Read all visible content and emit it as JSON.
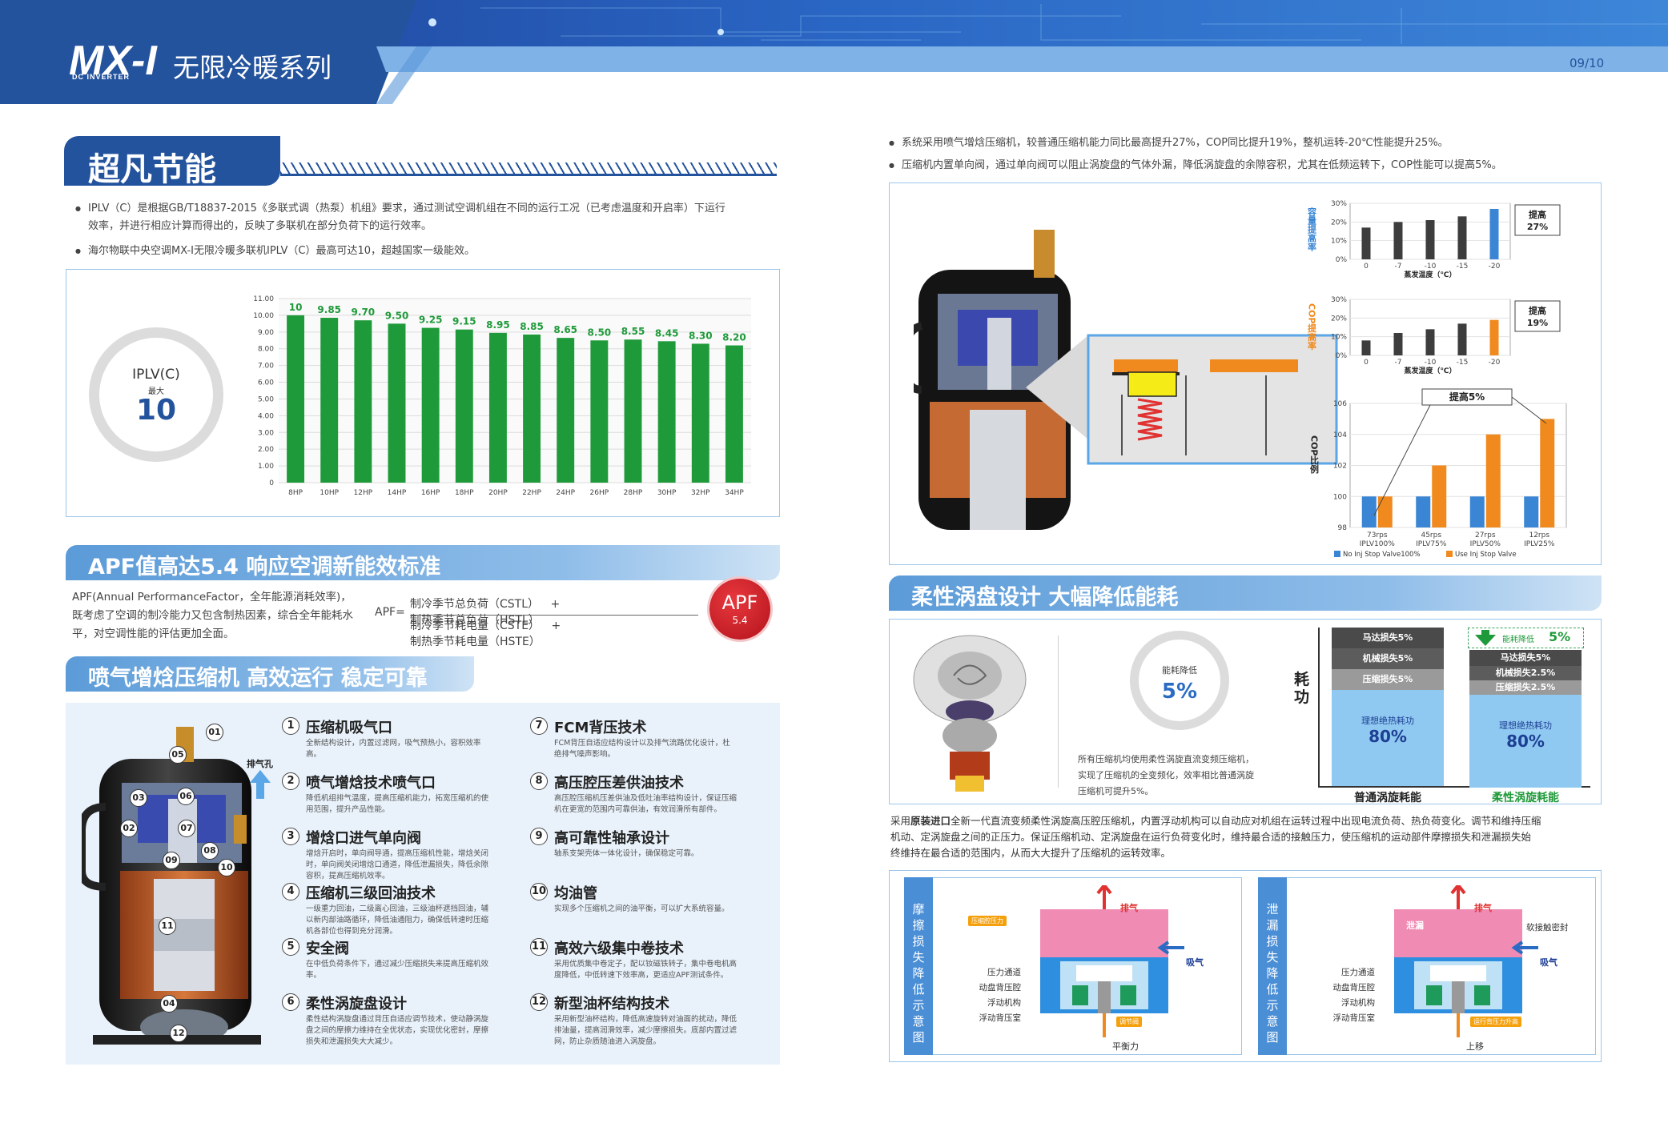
{
  "header": {
    "logo": "MX-I",
    "logo_sub": "DC INVERTER",
    "title": "无限冷暖系列",
    "page": "09/10"
  },
  "s1": {
    "title": "超凡节能",
    "b1a": "IPLV（C）是根据GB/T18837-2015《多联式调（热泵）机组》要求，通过测试空调机组在不同的运行工况（已考虑温度和开启率）下运行",
    "b1b": "效率，并进行相应计算而得出的，反映了多联机在部分负荷下的运行效率。",
    "b2": "海尔物联中央空调MX-I无限冷暖多联机IPLV（C）最高可达10，超越国家一级能效。",
    "ring_l1": "IPLV(C)",
    "ring_l2": "最大",
    "ring_v": "10"
  },
  "chart_data": {
    "type": "bar",
    "categories": [
      "8HP",
      "10HP",
      "12HP",
      "14HP",
      "16HP",
      "18HP",
      "20HP",
      "22HP",
      "24HP",
      "26HP",
      "28HP",
      "30HP",
      "32HP",
      "34HP"
    ],
    "values": [
      10,
      9.85,
      9.7,
      9.5,
      9.25,
      9.15,
      8.95,
      8.85,
      8.65,
      8.5,
      8.55,
      8.45,
      8.3,
      8.2
    ],
    "value_labels": [
      "10",
      "9.85",
      "9.70",
      "9.50",
      "9.25",
      "9.15",
      "8.95",
      "8.85",
      "8.65",
      "8.50",
      "8.55",
      "8.45",
      "8.30",
      "8.20"
    ],
    "yticks": [
      "11.00",
      "10.00",
      "9.00",
      "8.00",
      "7.00",
      "6.00",
      "5.00",
      "4.00",
      "3.00",
      "2.00",
      "1.00",
      "0"
    ],
    "ylim": [
      0,
      11
    ],
    "color": "#1f9a3a"
  },
  "s2": {
    "title": "APF值高达5.4 响应空调新能效标准",
    "t1": "APF(Annual PerformanceFactor，全年能源消耗效率)，",
    "t2": "既考虑了空调的制冷能力又包含制热因素，综合全年能耗水",
    "t3": "平，对空调性能的评估更加全面。",
    "eq": "APF=",
    "n1": "制冷季节总负荷（CSTL）",
    "plus": "+",
    "n2": "制热季节总负荷（HSTL）",
    "d1": "制冷季节耗电量（CSTE）",
    "d2": "制热季节耗电量（HSTE）",
    "badge": "APF",
    "badge_v": "5.4"
  },
  "s3": {
    "title": "喷气增焓压缩机 高效运行 稳定可靠",
    "exhaust": "排气孔",
    "callouts": [
      "01",
      "05",
      "03",
      "06",
      "02",
      "07",
      "08",
      "09",
      "10",
      "11",
      "04",
      "12"
    ],
    "features": [
      {
        "n": "1",
        "t": "压缩机吸气口",
        "d1": "全新结构设计，内置过滤网，吸气预热小，容积效率",
        "d2": "高。"
      },
      {
        "n": "2",
        "t": "喷气增焓技术喷气口",
        "d1": "降低机组排气温度，提高压缩机能力，拓宽压缩机的使",
        "d2": "用范围，提升产品性能。"
      },
      {
        "n": "3",
        "t": "增焓口进气单向阀",
        "d1": "增焓开启时，单向阀导通，提高压缩机性能，增焓关闭",
        "d2": "时，单向阀关闭增焓口通道，降低泄漏损失，降低余隙",
        "d3": "容积，提高压缩机效率。"
      },
      {
        "n": "4",
        "t": "压缩机三级回油技术",
        "d1": "一级重力回油，二级离心回油，三级油杯遮挡回油，辅",
        "d2": "以新内部油路循环，降低油通阻力，确保低转速时压缩",
        "d3": "机各部位也得到充分润滑。"
      },
      {
        "n": "5",
        "t": "安全阀",
        "d1": "在中低负荷条件下，通过减少压缩损失来提高压缩机效",
        "d2": "率。"
      },
      {
        "n": "6",
        "t": "柔性涡旋盘设计",
        "d1": "柔性结构涡旋盘通过背压自适应调节技术，使动静涡旋",
        "d2": "盘之间的摩擦力维持在全优状态，实现优化密封，摩擦",
        "d3": "损失和泄漏损失大大减少。"
      },
      {
        "n": "7",
        "t": "FCM背压技术",
        "d1": "FCM背压自适应结构设计以及排气流路优化设计，杜",
        "d2": "绝排气噪声影响。"
      },
      {
        "n": "8",
        "t": "高压腔压差供油技术",
        "d1": "高压腔压缩机压差供油及低吐油率结构设计，保证压缩",
        "d2": "机在更宽的范围内可靠供油，有效润滑所有部件。"
      },
      {
        "n": "9",
        "t": "高可靠性轴承设计",
        "d1": "轴系支架壳体一体化设计，确保稳定可靠。"
      },
      {
        "n": "10",
        "t": "均油管",
        "d1": "实现多个压缩机之间的油平衡，可以扩大系统容量。"
      },
      {
        "n": "11",
        "t": "高效六级集中卷技术",
        "d1": "采用优质集中卷定子，配以钕磁铁转子，集中卷电机高",
        "d2": "度降低，中低转速下效率高，更适应APF测试条件。"
      },
      {
        "n": "12",
        "t": "新型油杯结构技术",
        "d1": "采用新型油杯结构，降低高速旋转对油面的扰动，降低",
        "d2": "排油量，提高润滑效率，减少摩擦损失。底部内置过滤",
        "d3": "网，防止杂质随油进入涡旋盘。"
      }
    ]
  },
  "r1": {
    "b1": "系统采用喷气增焓压缩机，较普通压缩机能力同比最高提升27%，COP同比提升19%，整机运转-20℃性能提升25%。",
    "b2": "压缩机内置单向阀，通过单向阀可以阻止涡旋盘的气体外漏，降低涡旋盘的余隙容积，尤其在低频运转下，COP性能可以提高5%。"
  },
  "mini": [
    {
      "ylabel": "容量提高率",
      "xlabel": "蒸发温度（℃）",
      "xcats": [
        "0",
        "-7",
        "-10",
        "-15",
        "-20"
      ],
      "values": [
        17,
        20,
        21,
        23,
        27
      ],
      "yticks": [
        "30%",
        "20%",
        "10%",
        "0%"
      ],
      "ylim": [
        0,
        30
      ],
      "callout": "提高",
      "callout_v": "27%",
      "color_a": "#3d3d3d",
      "color_b": "#3a85d4",
      "label_color": "#3a85d4"
    },
    {
      "ylabel": "COP提高率",
      "xlabel": "蒸发温度（℃）",
      "xcats": [
        "0",
        "-7",
        "-10",
        "-15",
        "-20"
      ],
      "values": [
        8,
        12,
        14,
        17,
        19
      ],
      "yticks": [
        "30%",
        "20%",
        "10%",
        "0%"
      ],
      "ylim": [
        0,
        30
      ],
      "callout": "提高",
      "callout_v": "19%",
      "color_a": "#3d3d3d",
      "color_b": "#f08a1e",
      "label_color": "#f08a1e"
    }
  ],
  "cop_chart": {
    "type": "bar",
    "ylabel": "COP比例",
    "title_callout": "提高5%",
    "categories": [
      "73rps IPLV100%",
      "45rps IPLV75%",
      "27rps IPLV50%",
      "12rps IPLV25%"
    ],
    "cat_top": [
      "73rps",
      "45rps",
      "27rps",
      "12rps"
    ],
    "cat_bot": [
      "IPLV100%",
      "IPLV75%",
      "IPLV50%",
      "IPLV25%"
    ],
    "series": [
      {
        "name": "No Inj Stop Valve100%",
        "values": [
          100,
          100,
          100,
          100
        ],
        "color": "#3a85d4"
      },
      {
        "name": "Use Inj Stop Valve",
        "values": [
          100,
          102,
          104,
          105
        ],
        "color": "#f08a1e"
      }
    ],
    "yticks": [
      "106",
      "104",
      "102",
      "100",
      "98"
    ],
    "ylim": [
      98,
      106
    ]
  },
  "s4": {
    "title": "柔性涡盘设计 大幅降低能耗",
    "ring_l": "能耗降低",
    "ring_v": "5%",
    "p1": "所有压缩机均使用柔性涡旋直流变频压缩机，",
    "p2": "实现了压缩机的全变频化，效率相比普通涡旋",
    "p3": "压缩机可提升5%。",
    "energy_axis": "耗功",
    "drop_label": "能耗降低",
    "drop_v": "5%",
    "normal": {
      "motor": "马达损失5%",
      "mech": "机械损失5%",
      "comp": "压缩损失5%",
      "ideal": "理想绝热耗功",
      "ideal_v": "80%",
      "label": "普通涡旋耗能"
    },
    "flex": {
      "motor": "马达损失5%",
      "mech": "机械损失2.5%",
      "comp": "压缩损失2.5%",
      "ideal": "理想绝热耗功",
      "ideal_v": "80%",
      "label": "柔性涡旋耗能"
    },
    "desc1_pre": "采用",
    "desc1_bold": "原装进口",
    "desc1_post": "全新一代直流变频柔性涡旋高压腔压缩机，内置浮动机构可以自动应对机组在运转过程中出现电流负荷、热负荷变化。调节和维持压缩",
    "desc2": "机动、定涡旋盘之间的正压力。保证压缩机动、定涡旋盘在运行负荷变化时，维持最合适的接触压力，使压缩机的运动部件摩擦损失和泄漏损失始",
    "desc3": "终维持在最合适的范围内，从而大大提升了压缩机的运转效率。"
  },
  "diag": [
    {
      "side": "摩擦损失降低示意图",
      "exhaust": "排气",
      "intake": "吸气",
      "tag1": "压缩腔压力",
      "labels": [
        "压力通道",
        "动盘背压腔",
        "浮动机构",
        "浮动背压室"
      ],
      "tag2": "调节阀",
      "bottom": "平衡力"
    },
    {
      "side": "泄漏损失降低示意图",
      "exhaust": "排气",
      "intake": "吸气",
      "leak": "泄漏",
      "seal": "软接触密封",
      "labels": [
        "压力通道",
        "动盘背压腔",
        "浮动机构",
        "浮动背压室"
      ],
      "tag2": "运行背压力升高",
      "bottom": "上移"
    }
  ]
}
